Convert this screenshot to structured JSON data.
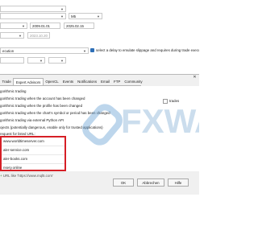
{
  "settings": {
    "symbol_value": "M5",
    "date_from": "2009.01.01",
    "date_to": "2025.02.15",
    "forward_date": "2023.10.20",
    "execution_value": "ecution",
    "delay_hint": "select a delay to emulate slippage and requires during trade execu"
  },
  "dialog": {
    "tabs": [
      {
        "label": "Trade"
      },
      {
        "label": "Expert Advisors"
      },
      {
        "label": "OpenCL"
      },
      {
        "label": "Events"
      },
      {
        "label": "Notifications"
      },
      {
        "label": "Email"
      },
      {
        "label": "FTP"
      },
      {
        "label": "Community"
      }
    ],
    "options": [
      {
        "label": "gorithmic trading"
      },
      {
        "label": "gorithmic trading when the account has been changed"
      },
      {
        "label": "gorithmic trading when the profile has been changed"
      },
      {
        "label": "gorithmic trading when the chart's symbol or period has been changed"
      },
      {
        "label": "gorithmic trading via external Python API"
      },
      {
        "label": "ojects (potentially dangerous, enable only for trusted applications)"
      },
      {
        "label": "request for listed URL:"
      }
    ],
    "right_text": "trades",
    "urls": [
      {
        "value": "www.worldtimeserver.com"
      },
      {
        "value": "aler-service.com"
      },
      {
        "value": "aler-books.com"
      },
      {
        "value": "nsery.online"
      }
    ],
    "url_hint": "URL like 'https://www.mql5.com'",
    "buttons": {
      "ok": "OK",
      "cancel": "Abbrechen",
      "help": "Hilfe"
    }
  },
  "watermark": {
    "text": "FXWA"
  }
}
